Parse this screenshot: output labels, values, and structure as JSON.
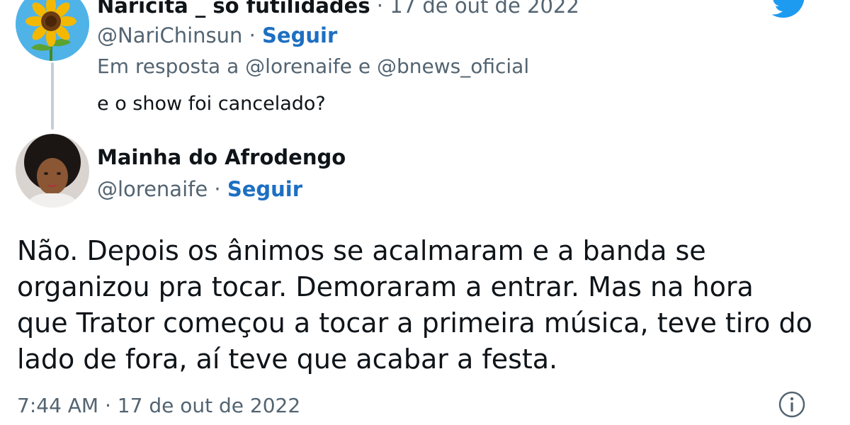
{
  "parent_tweet": {
    "display_name": "Naricita _ só futilidades",
    "separator": " · ",
    "date": "17 de out de 2022",
    "handle": "@NariChinsun",
    "follow_separator": " · ",
    "follow_label": "Seguir",
    "reply_to_text": "Em resposta a @lorenaife e @bnews_oficial",
    "text": "e o show foi cancelado?",
    "avatar_icon": "sunflower-avatar"
  },
  "reply_tweet": {
    "display_name": "Mainha do Afrodengo",
    "handle": "@lorenaife",
    "follow_separator": " · ",
    "follow_label": "Seguir",
    "text": "Não. Depois os ânimos se acalmaram e a banda se\norganizou pra tocar. Demoraram a entrar. Mas na hora\nque Trator começou a tocar a primeira música, teve tiro do\nlado de fora, aí teve que acabar a festa.",
    "time": "7:44 AM",
    "meta_separator": " · ",
    "date": "17 de out de 2022",
    "avatar_icon": "person-avatar"
  },
  "icons": {
    "brand": "twitter-bird-icon",
    "info": "info-icon"
  },
  "colors": {
    "brand": "#1d9bf0",
    "follow_link": "#1d6fc2",
    "muted_text": "#536471",
    "thread_line": "#c4cfd6"
  }
}
